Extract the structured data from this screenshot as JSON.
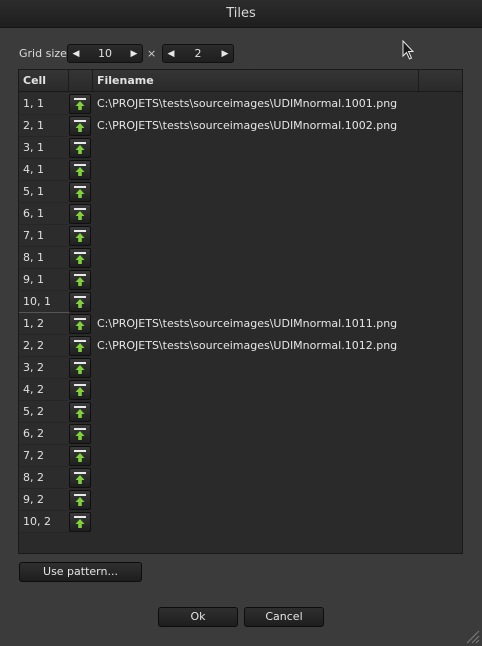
{
  "window": {
    "title": "Tiles"
  },
  "grid": {
    "label": "Grid size:",
    "cols": "10",
    "rows": "2",
    "separator": "×"
  },
  "table": {
    "headers": [
      "Cell",
      "",
      "Filename"
    ],
    "rows": [
      {
        "cell": "1, 1",
        "filename": "C:\\PROJETS\\tests\\sourceimages\\UDIMnormal.1001.png"
      },
      {
        "cell": "2, 1",
        "filename": "C:\\PROJETS\\tests\\sourceimages\\UDIMnormal.1002.png"
      },
      {
        "cell": "3, 1",
        "filename": ""
      },
      {
        "cell": "4, 1",
        "filename": ""
      },
      {
        "cell": "5, 1",
        "filename": ""
      },
      {
        "cell": "6, 1",
        "filename": ""
      },
      {
        "cell": "7, 1",
        "filename": ""
      },
      {
        "cell": "8, 1",
        "filename": ""
      },
      {
        "cell": "9, 1",
        "filename": ""
      },
      {
        "cell": "10, 1",
        "filename": ""
      },
      {
        "cell": "1, 2",
        "filename": "C:\\PROJETS\\tests\\sourceimages\\UDIMnormal.1011.png"
      },
      {
        "cell": "2, 2",
        "filename": "C:\\PROJETS\\tests\\sourceimages\\UDIMnormal.1012.png"
      },
      {
        "cell": "3, 2",
        "filename": ""
      },
      {
        "cell": "4, 2",
        "filename": ""
      },
      {
        "cell": "5, 2",
        "filename": ""
      },
      {
        "cell": "6, 2",
        "filename": ""
      },
      {
        "cell": "7, 2",
        "filename": ""
      },
      {
        "cell": "8, 2",
        "filename": ""
      },
      {
        "cell": "9, 2",
        "filename": ""
      },
      {
        "cell": "10, 2",
        "filename": ""
      }
    ]
  },
  "buttons": {
    "use_pattern": "Use pattern...",
    "ok": "Ok",
    "cancel": "Cancel"
  },
  "icons": {
    "row_button": "load-file-icon",
    "spin_left": "arrow-left-icon",
    "spin_right": "arrow-right-icon"
  },
  "colors": {
    "icon_green": "#7fd23a"
  }
}
